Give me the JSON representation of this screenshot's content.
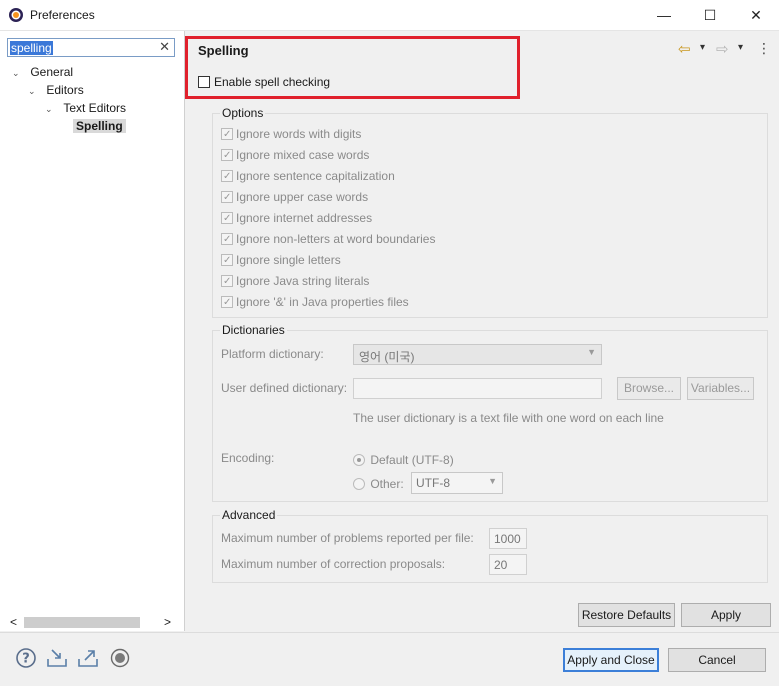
{
  "window": {
    "title": "Preferences",
    "minimize": "—",
    "maximize": "☐",
    "close": "✕"
  },
  "filter": {
    "value": "spelling",
    "clear": "✕"
  },
  "tree": {
    "items": [
      {
        "label": "General",
        "arrow": "⌄"
      },
      {
        "label": "Editors",
        "arrow": "⌄"
      },
      {
        "label": "Text Editors",
        "arrow": "⌄"
      },
      {
        "label": "Spelling",
        "selected": true
      }
    ]
  },
  "scroll": {
    "left_arrow": "<",
    "right_arrow": ">"
  },
  "page": {
    "title": "Spelling",
    "enable_label": "Enable spell checking",
    "enable_checked": false,
    "nav": {
      "back": "⇦",
      "forward": "⇨",
      "dropdown": "▾",
      "menu": "⋮"
    }
  },
  "options": {
    "title": "Options",
    "items": [
      "Ignore words with digits",
      "Ignore mixed case words",
      "Ignore sentence capitalization",
      "Ignore upper case words",
      "Ignore internet addresses",
      "Ignore non-letters at word boundaries",
      "Ignore single letters",
      "Ignore Java string literals",
      "Ignore '&' in Java properties files"
    ]
  },
  "dictionaries": {
    "title": "Dictionaries",
    "platform_label": "Platform dictionary:",
    "platform_value": "영어 (미국)",
    "user_label": "User defined dictionary:",
    "user_value": "",
    "browse": "Browse...",
    "variables": "Variables...",
    "hint": "The user dictionary is a text file with one word on each line",
    "encoding_label": "Encoding:",
    "default_label": "Default (UTF-8)",
    "other_label": "Other:",
    "other_value": "UTF-8"
  },
  "advanced": {
    "title": "Advanced",
    "max_problems_label": "Maximum number of problems reported per file:",
    "max_problems_value": "1000",
    "max_proposals_label": "Maximum number of correction proposals:",
    "max_proposals_value": "20"
  },
  "buttons": {
    "restore": "Restore Defaults",
    "apply": "Apply",
    "apply_close": "Apply and Close",
    "cancel": "Cancel"
  }
}
